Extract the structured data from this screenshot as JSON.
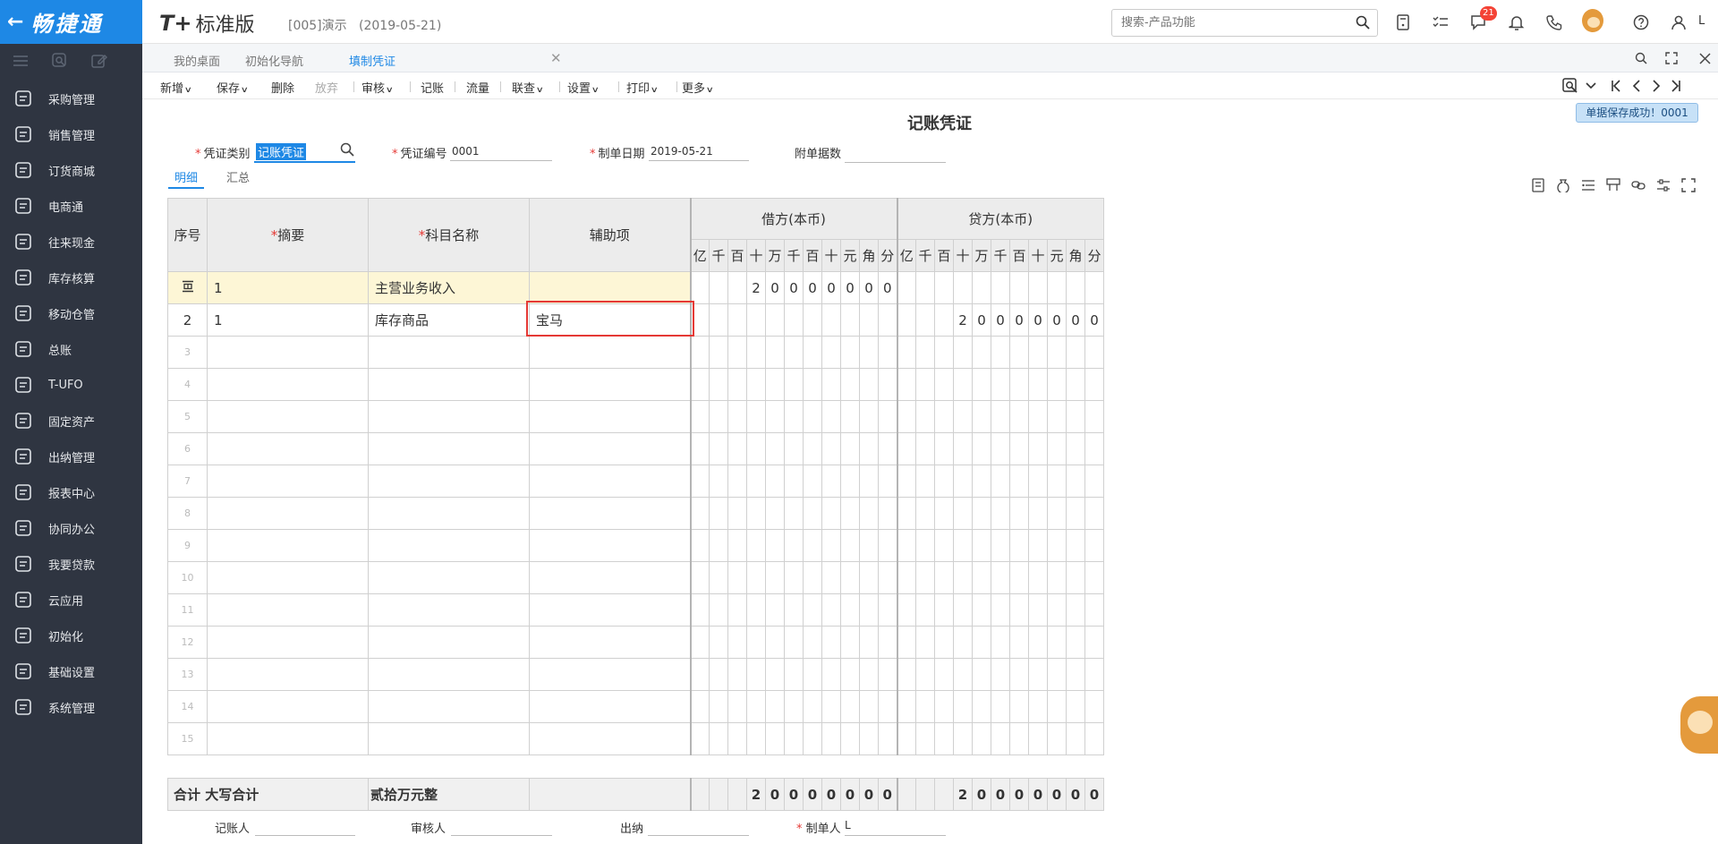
{
  "app": {
    "brand": "畅捷通",
    "product_mark": "T+",
    "product_name": "标准版",
    "account": "[005]演示",
    "account_date": "(2019-05-21)"
  },
  "search": {
    "placeholder": "搜索-产品功能"
  },
  "header": {
    "message_count": "21",
    "user": "L"
  },
  "sidebar": {
    "items": [
      {
        "label": "采购管理"
      },
      {
        "label": "销售管理"
      },
      {
        "label": "订货商城"
      },
      {
        "label": "电商通"
      },
      {
        "label": "往来现金"
      },
      {
        "label": "库存核算"
      },
      {
        "label": "移动仓管"
      },
      {
        "label": "总账"
      },
      {
        "label": "T-UFO"
      },
      {
        "label": "固定资产"
      },
      {
        "label": "出纳管理"
      },
      {
        "label": "报表中心"
      },
      {
        "label": "协同办公"
      },
      {
        "label": "我要贷款"
      },
      {
        "label": "云应用"
      },
      {
        "label": "初始化"
      },
      {
        "label": "基础设置"
      },
      {
        "label": "系统管理"
      }
    ]
  },
  "tabs": [
    {
      "label": "我的桌面"
    },
    {
      "label": "初始化导航"
    },
    {
      "label": "填制凭证"
    }
  ],
  "toolbar": {
    "new": "新增",
    "save": "保存",
    "delete": "删除",
    "discard": "放弃",
    "audit": "审核",
    "post": "记账",
    "flow": "流量",
    "query": "联查",
    "settings": "设置",
    "print": "打印",
    "more": "更多"
  },
  "voucher": {
    "title": "记账凭证",
    "toast": "单据保存成功！0001",
    "type_label": "凭证类别",
    "type_value": "记账凭证",
    "no_label": "凭证编号",
    "no_value": "0001",
    "date_label": "制单日期",
    "date_value": "2019-05-21",
    "attach_label": "附单据数",
    "tab_detail": "明细",
    "tab_summary": "汇总"
  },
  "table": {
    "headers": {
      "seq": "序号",
      "summary": "摘要",
      "account": "科目名称",
      "aux": "辅助项",
      "debit": "借方(本币)",
      "credit": "贷方(本币)"
    },
    "digit_units": [
      "亿",
      "千",
      "百",
      "十",
      "万",
      "千",
      "百",
      "十",
      "元",
      "角",
      "分"
    ],
    "rows": [
      {
        "seq": "",
        "summary": "1",
        "account": "主营业务收入",
        "aux": "",
        "debit": [
          "",
          "",
          "",
          "2",
          "0",
          "0",
          "0",
          "0",
          "0",
          "0",
          "0"
        ],
        "credit": [
          "",
          "",
          "",
          "",
          "",
          "",
          "",
          "",
          "",
          "",
          ""
        ]
      },
      {
        "seq": "2",
        "summary": "1",
        "account": "库存商品",
        "aux": "宝马",
        "debit": [
          "",
          "",
          "",
          "",
          "",
          "",
          "",
          "",
          "",
          "",
          ""
        ],
        "credit": [
          "",
          "",
          "",
          "2",
          "0",
          "0",
          "0",
          "0",
          "0",
          "0",
          "0"
        ]
      },
      {
        "seq": "3"
      },
      {
        "seq": "4"
      },
      {
        "seq": "5"
      },
      {
        "seq": "6"
      },
      {
        "seq": "7"
      },
      {
        "seq": "8"
      },
      {
        "seq": "9"
      },
      {
        "seq": "10"
      },
      {
        "seq": "11"
      },
      {
        "seq": "12"
      },
      {
        "seq": "13"
      },
      {
        "seq": "14"
      },
      {
        "seq": "15"
      }
    ],
    "total": {
      "label": "合计",
      "caps_label": "大写合计",
      "caps_value": "贰拾万元整",
      "debit": [
        "",
        "",
        "",
        "2",
        "0",
        "0",
        "0",
        "0",
        "0",
        "0",
        "0"
      ],
      "credit": [
        "",
        "",
        "",
        "2",
        "0",
        "0",
        "0",
        "0",
        "0",
        "0",
        "0"
      ]
    }
  },
  "signatures": {
    "poster": "记账人",
    "auditor": "审核人",
    "cashier": "出纳",
    "maker": "制单人",
    "maker_value": "L"
  },
  "colors": {
    "brand": "#1e88e5",
    "sidebar": "#2f3541",
    "required": "#e53935",
    "selected_row": "#fdf6d6"
  }
}
